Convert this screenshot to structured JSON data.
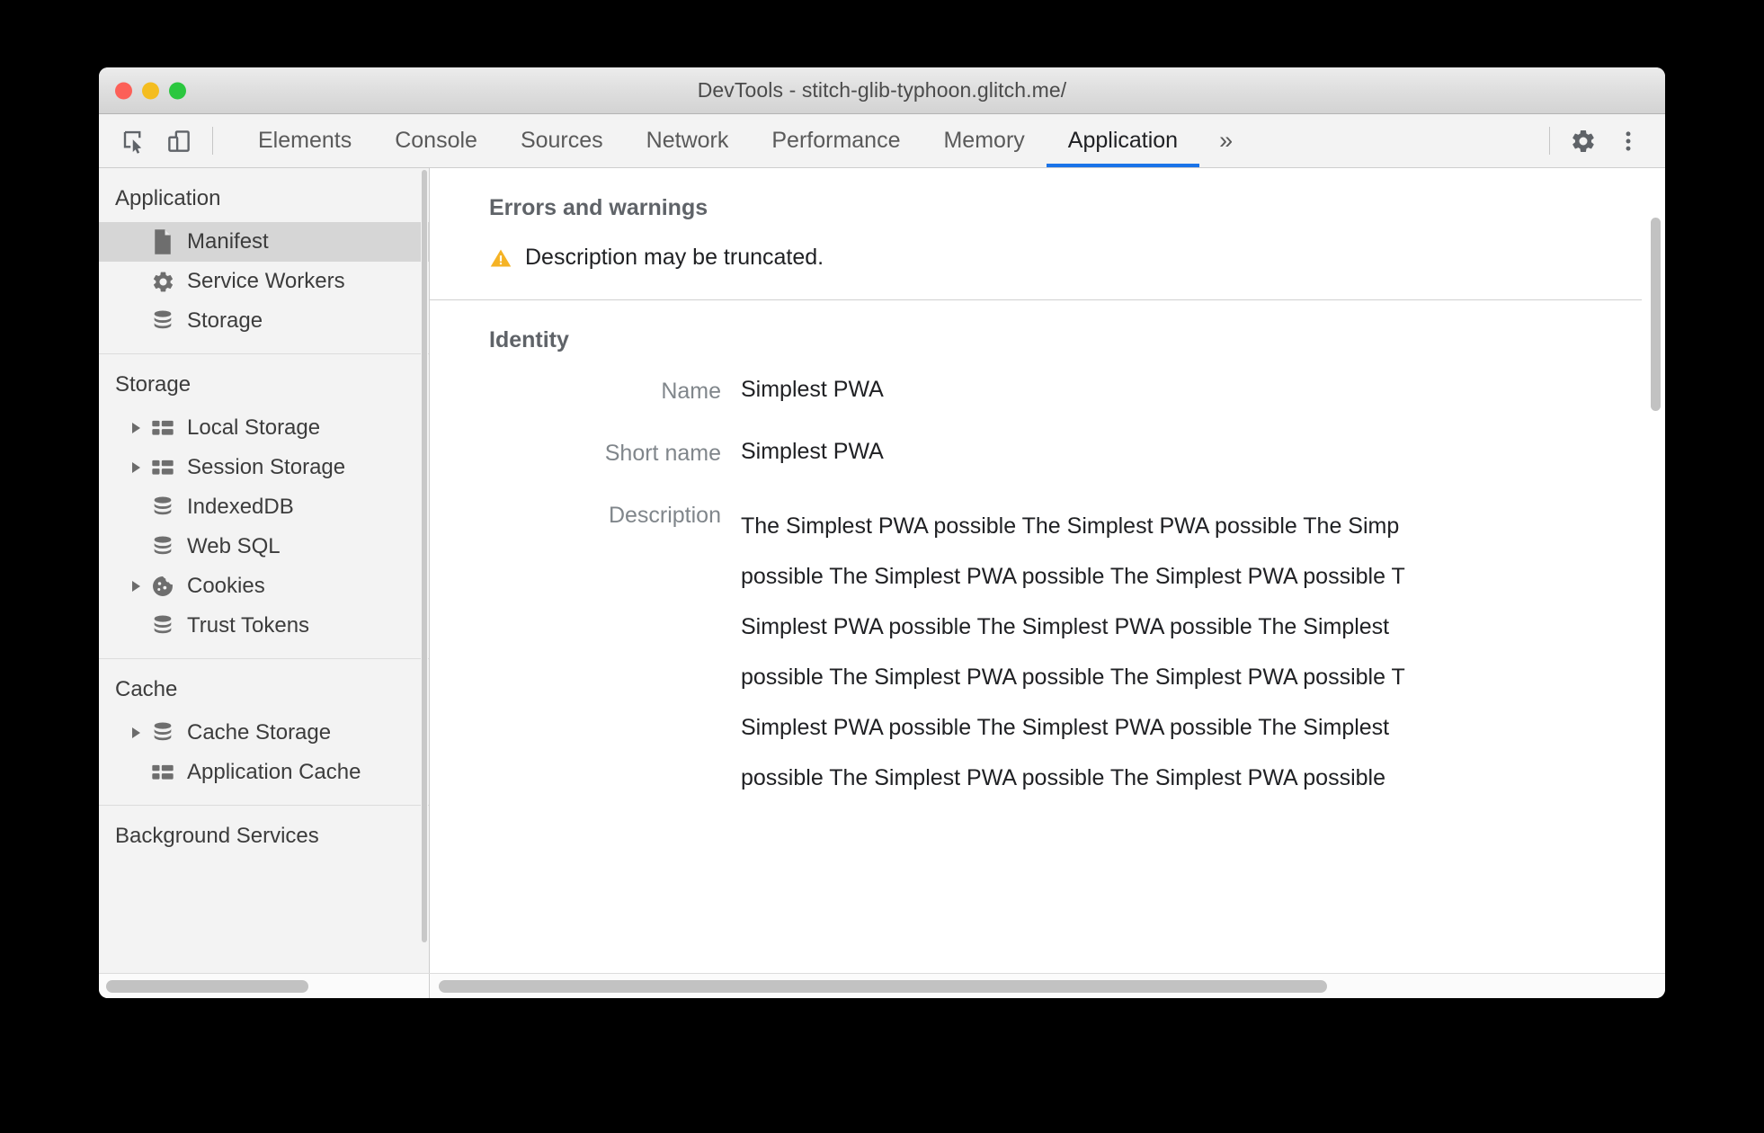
{
  "window": {
    "title": "DevTools - stitch-glib-typhoon.glitch.me/",
    "traffic_lights": [
      "close-red",
      "minimize-yellow",
      "zoom-green"
    ]
  },
  "toolbar": {
    "inspect_icon": "inspect-element-icon",
    "device_icon": "device-toolbar-icon",
    "tabs": [
      {
        "label": "Elements",
        "active": false
      },
      {
        "label": "Console",
        "active": false
      },
      {
        "label": "Sources",
        "active": false
      },
      {
        "label": "Network",
        "active": false
      },
      {
        "label": "Performance",
        "active": false
      },
      {
        "label": "Memory",
        "active": false
      },
      {
        "label": "Application",
        "active": true
      }
    ],
    "overflow_label": "»",
    "settings_icon": "gear-icon",
    "more_icon": "more-vertical-icon",
    "active_tab_color": "#1a73e8"
  },
  "sidebar": {
    "sections": [
      {
        "header": "Application",
        "items": [
          {
            "label": "Manifest",
            "icon": "document-icon",
            "selected": true,
            "expandable": false
          },
          {
            "label": "Service Workers",
            "icon": "gear-icon",
            "selected": false,
            "expandable": false
          },
          {
            "label": "Storage",
            "icon": "database-icon",
            "selected": false,
            "expandable": false
          }
        ]
      },
      {
        "header": "Storage",
        "items": [
          {
            "label": "Local Storage",
            "icon": "table-icon",
            "selected": false,
            "expandable": true
          },
          {
            "label": "Session Storage",
            "icon": "table-icon",
            "selected": false,
            "expandable": true
          },
          {
            "label": "IndexedDB",
            "icon": "database-icon",
            "selected": false,
            "expandable": false
          },
          {
            "label": "Web SQL",
            "icon": "database-icon",
            "selected": false,
            "expandable": false
          },
          {
            "label": "Cookies",
            "icon": "cookie-icon",
            "selected": false,
            "expandable": true
          },
          {
            "label": "Trust Tokens",
            "icon": "database-icon",
            "selected": false,
            "expandable": false
          }
        ]
      },
      {
        "header": "Cache",
        "items": [
          {
            "label": "Cache Storage",
            "icon": "database-icon",
            "selected": false,
            "expandable": true
          },
          {
            "label": "Application Cache",
            "icon": "table-icon",
            "selected": false,
            "expandable": false
          }
        ]
      },
      {
        "header": "Background Services",
        "items": []
      }
    ]
  },
  "main": {
    "errors_section": {
      "title": "Errors and warnings",
      "warning_icon": "warning-triangle-icon",
      "warning_color": "#f5b325",
      "messages": [
        "Description may be truncated."
      ]
    },
    "identity_section": {
      "title": "Identity",
      "fields": [
        {
          "label": "Name",
          "value": "Simplest PWA"
        },
        {
          "label": "Short name",
          "value": "Simplest PWA"
        }
      ],
      "description_label": "Description",
      "description_lines": [
        "The Simplest PWA possible The Simplest PWA possible The Simp",
        "possible The Simplest PWA possible The Simplest PWA possible T",
        "Simplest PWA possible The Simplest PWA possible The Simplest",
        "possible The Simplest PWA possible The Simplest PWA possible T",
        "Simplest PWA possible The Simplest PWA possible The Simplest",
        "possible The Simplest PWA possible The Simplest PWA possible"
      ]
    }
  }
}
